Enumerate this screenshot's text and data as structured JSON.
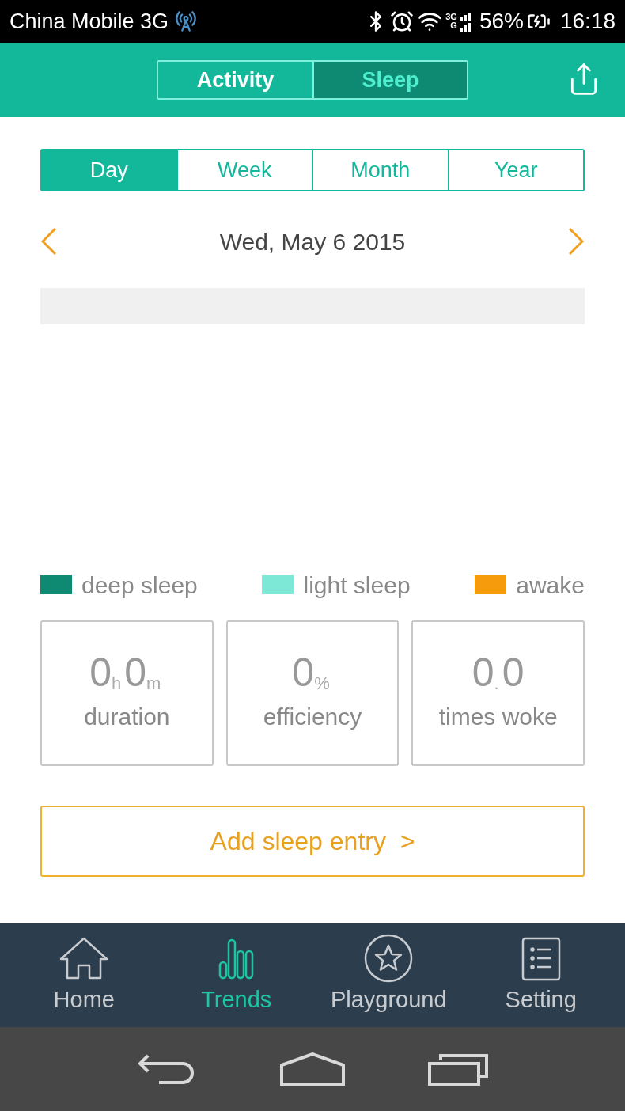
{
  "status_bar": {
    "carrier": "China Mobile 3G",
    "network_top": "3G",
    "network_bottom": "G",
    "battery": "56%",
    "time": "16:18"
  },
  "header": {
    "tabs": [
      {
        "label": "Activity",
        "selected": false
      },
      {
        "label": "Sleep",
        "selected": true
      }
    ]
  },
  "period_tabs": [
    {
      "label": "Day",
      "selected": true
    },
    {
      "label": "Week",
      "selected": false
    },
    {
      "label": "Month",
      "selected": false
    },
    {
      "label": "Year",
      "selected": false
    }
  ],
  "date": "Wed, May 6 2015",
  "legend": [
    {
      "label": "deep sleep",
      "color": "#0e8a72"
    },
    {
      "label": "light sleep",
      "color": "#7ee8d6"
    },
    {
      "label": "awake",
      "color": "#f59b0c"
    }
  ],
  "stats": [
    {
      "parts": [
        {
          "kind": "number",
          "text": "0"
        },
        {
          "kind": "unit",
          "text": "h"
        },
        {
          "kind": "number",
          "text": "0"
        },
        {
          "kind": "unit",
          "text": "m"
        }
      ],
      "label": "duration"
    },
    {
      "parts": [
        {
          "kind": "number",
          "text": "0"
        },
        {
          "kind": "unit",
          "text": "%"
        }
      ],
      "label": "efficiency"
    },
    {
      "parts": [
        {
          "kind": "number",
          "text": "0"
        },
        {
          "kind": "unit",
          "text": "."
        },
        {
          "kind": "number",
          "text": "0"
        }
      ],
      "label": "times woke"
    }
  ],
  "add_button": "Add sleep entry  >",
  "bottom_nav": [
    {
      "label": "Home",
      "selected": false
    },
    {
      "label": "Trends",
      "selected": true
    },
    {
      "label": "Playground",
      "selected": false
    },
    {
      "label": "Setting",
      "selected": false
    }
  ]
}
